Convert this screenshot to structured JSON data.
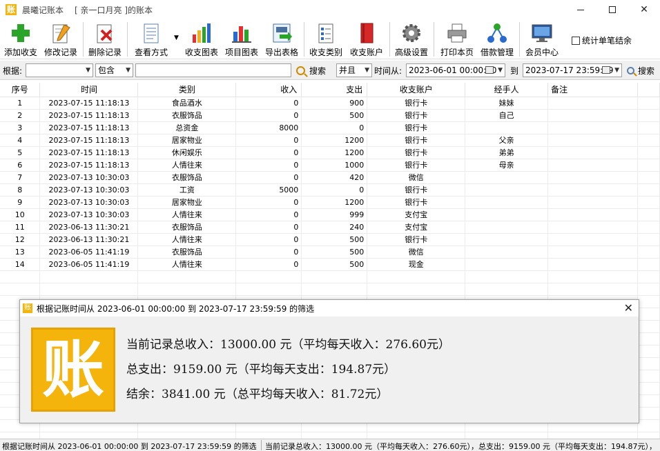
{
  "window": {
    "app_logo_glyph": "账",
    "app_title": "晨曦记账本",
    "book_title": "[ 亲一口月亮 ]的账本"
  },
  "toolbar": {
    "items": [
      {
        "label": "添加收支",
        "icon": "add-icon"
      },
      {
        "label": "修改记录",
        "icon": "edit-icon"
      },
      {
        "label": "删除记录",
        "icon": "delete-icon"
      },
      {
        "label": "查看方式",
        "icon": "view-icon"
      },
      {
        "label": "收支图表",
        "icon": "bar-chart-icon"
      },
      {
        "label": "项目图表",
        "icon": "project-chart-icon"
      },
      {
        "label": "导出表格",
        "icon": "export-icon"
      },
      {
        "label": "收支类别",
        "icon": "category-icon"
      },
      {
        "label": "收支账户",
        "icon": "account-icon"
      },
      {
        "label": "高级设置",
        "icon": "gear-icon"
      },
      {
        "label": "打印本页",
        "icon": "printer-icon"
      },
      {
        "label": "借款管理",
        "icon": "network-icon"
      },
      {
        "label": "会员中心",
        "icon": "monitor-icon"
      }
    ],
    "stat_checkbox_label": "统计单笔结余"
  },
  "filter": {
    "by_label": "根据:",
    "field_value": "",
    "match_value": "包含",
    "keyword_value": "",
    "search_label": "搜索",
    "logic_value": "并且",
    "time_from_label": "时间从:",
    "time_from_value": "2023-06-01 00:00:00",
    "to_label": "到",
    "time_to_value": "2023-07-17 23:59:59",
    "search2_label": "搜索"
  },
  "table": {
    "columns": [
      "序号",
      "时间",
      "类别",
      "收入",
      "支出",
      "收支账户",
      "经手人",
      "备注"
    ],
    "rows": [
      [
        "1",
        "2023-07-15 11:18:13",
        "食品酒水",
        "0",
        "900",
        "银行卡",
        "妹妹",
        ""
      ],
      [
        "2",
        "2023-07-15 11:18:13",
        "衣服饰品",
        "0",
        "500",
        "银行卡",
        "自己",
        ""
      ],
      [
        "3",
        "2023-07-15 11:18:13",
        "总资金",
        "8000",
        "0",
        "银行卡",
        "",
        ""
      ],
      [
        "4",
        "2023-07-15 11:18:13",
        "居家物业",
        "0",
        "1200",
        "银行卡",
        "父亲",
        ""
      ],
      [
        "5",
        "2023-07-15 11:18:13",
        "休闲娱乐",
        "0",
        "1200",
        "银行卡",
        "弟弟",
        ""
      ],
      [
        "6",
        "2023-07-15 11:18:13",
        "人情往来",
        "0",
        "1000",
        "银行卡",
        "母亲",
        ""
      ],
      [
        "7",
        "2023-07-13 10:30:03",
        "衣服饰品",
        "0",
        "420",
        "微信",
        "",
        ""
      ],
      [
        "8",
        "2023-07-13 10:30:03",
        "工资",
        "5000",
        "0",
        "银行卡",
        "",
        ""
      ],
      [
        "9",
        "2023-07-13 10:30:03",
        "居家物业",
        "0",
        "1200",
        "银行卡",
        "",
        ""
      ],
      [
        "10",
        "2023-07-13 10:30:03",
        "人情往来",
        "0",
        "999",
        "支付宝",
        "",
        ""
      ],
      [
        "11",
        "2023-06-13 11:30:21",
        "衣服饰品",
        "0",
        "240",
        "支付宝",
        "",
        ""
      ],
      [
        "12",
        "2023-06-13 11:30:21",
        "人情往来",
        "0",
        "500",
        "银行卡",
        "",
        ""
      ],
      [
        "13",
        "2023-06-05 11:41:19",
        "衣服饰品",
        "0",
        "500",
        "微信",
        "",
        ""
      ],
      [
        "14",
        "2023-06-05 11:41:19",
        "人情往来",
        "0",
        "500",
        "现金",
        "",
        ""
      ]
    ]
  },
  "dialog": {
    "icon_glyph": "账",
    "title": "根据记账时间从 2023-06-01 00:00:00 到 2023-07-17 23:59:59 的筛选",
    "close_glyph": "✕",
    "logo_glyph": "账",
    "line1": "当前记录总收入：13000.00 元（平均每天收入：276.60元）",
    "line2": "总支出：9159.00 元（平均每天支出：194.87元）",
    "line3": "结余：3841.00 元（总平均每天收入：81.72元）"
  },
  "statusbar": {
    "left": "根据记账时间从 2023-06-01 00:00:00 到 2023-07-17 23:59:59 的筛选",
    "right": "当前记录总收入：13000.00 元（平均每天收入：276.60元），总支出：9159.00 元（平均每天支出：194.87元），"
  }
}
